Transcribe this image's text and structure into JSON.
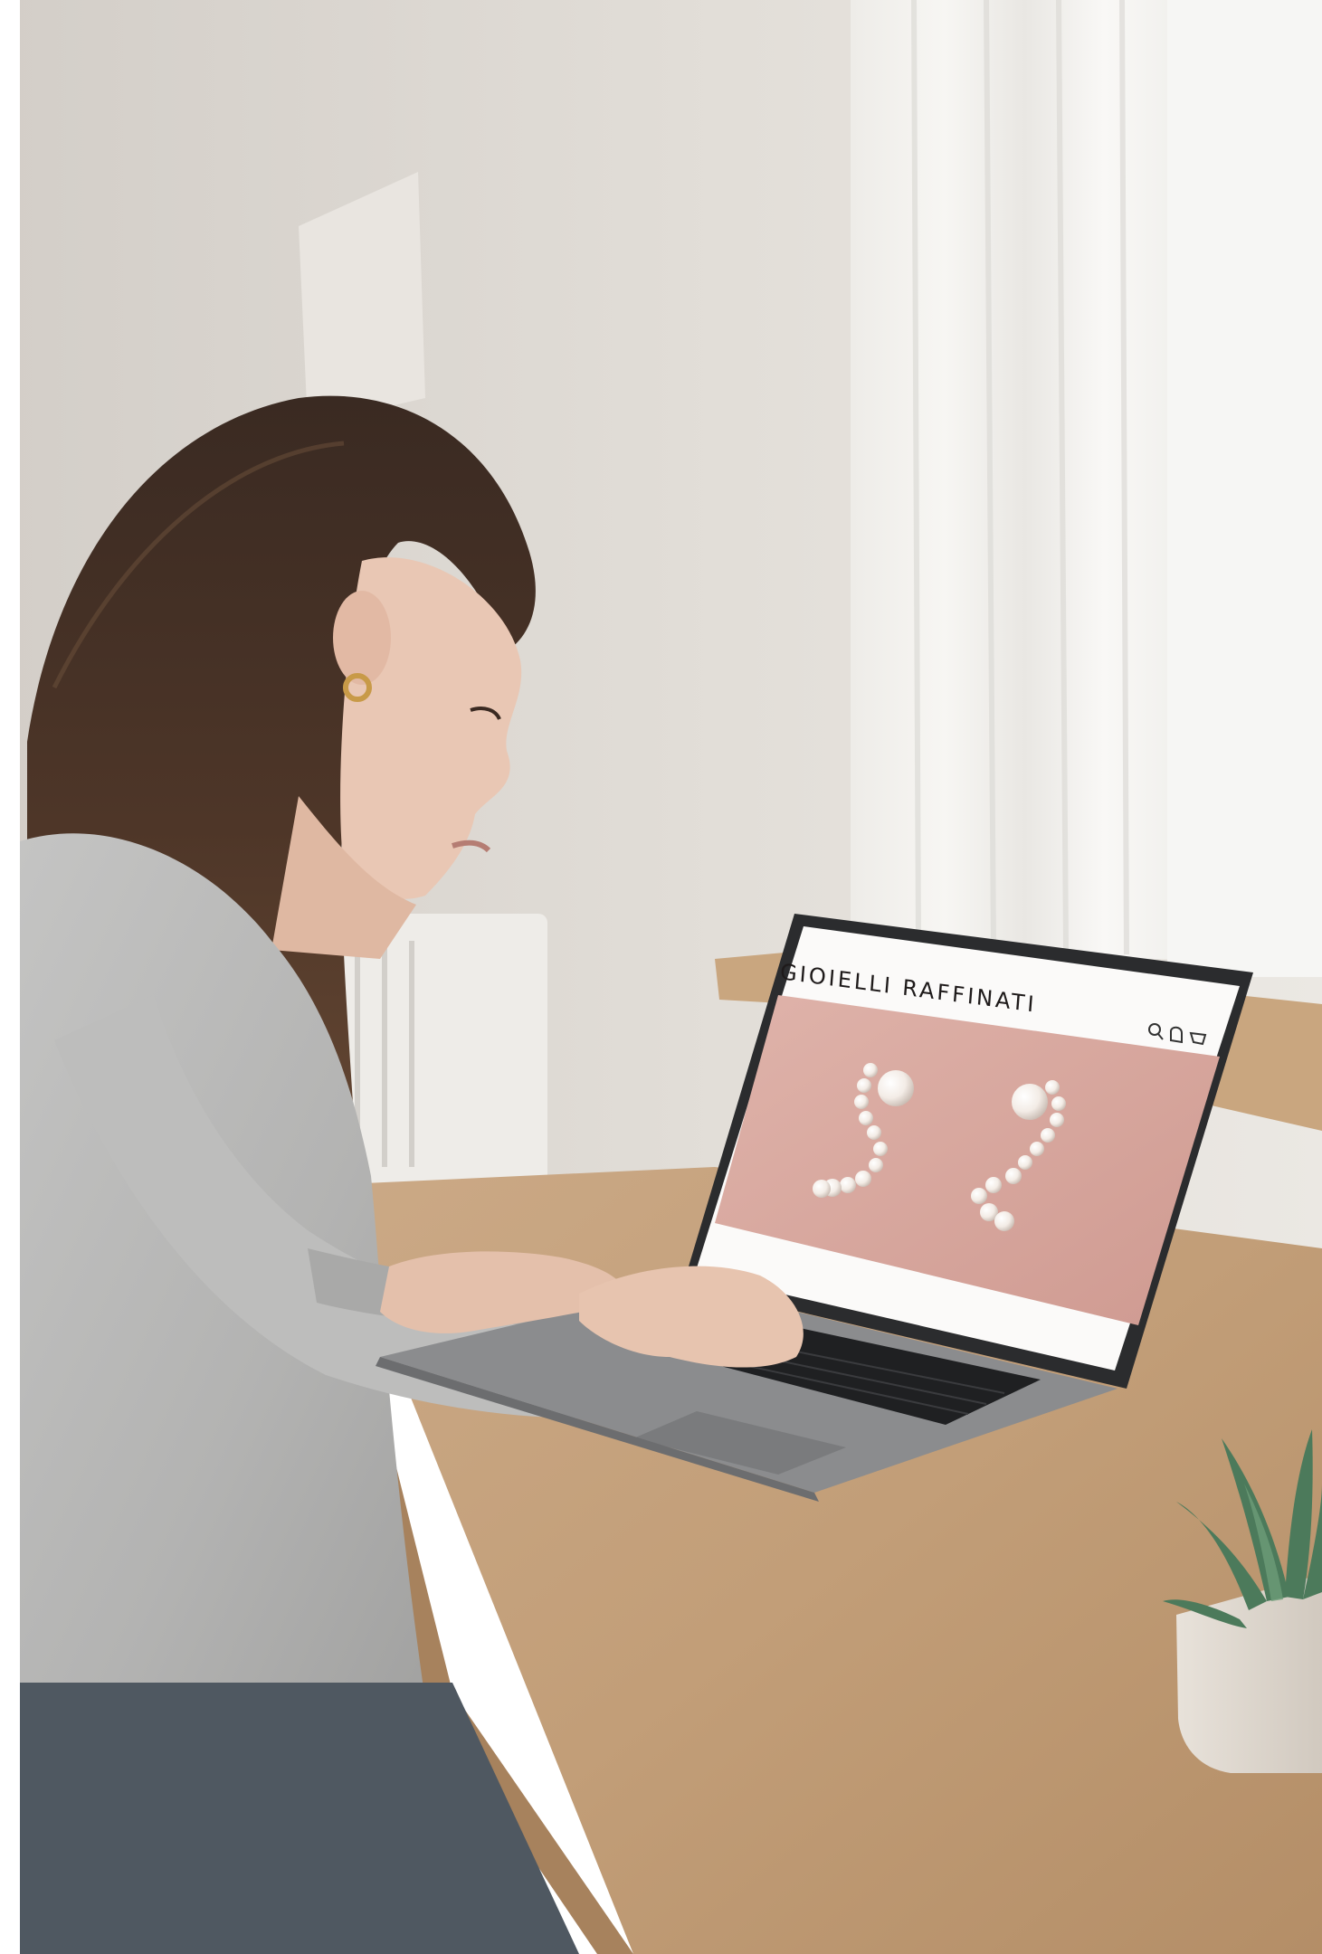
{
  "scene": {
    "kind": "photograph",
    "content": "person at a desk browsing a jewelry store on a laptop"
  },
  "laptop_screen": {
    "site_brand": "GIOIELLI RAFFINATI",
    "header_icons": [
      "search-icon",
      "bell-icon",
      "cart-icon"
    ],
    "hero_image": "pearl-earrings"
  },
  "colors": {
    "wall": "#ddd9d3",
    "desk": "#c4a079",
    "sweater": "#b9b9b8",
    "hero_pink": "#d9a8a0",
    "laptop_body": "#5e5f61"
  }
}
